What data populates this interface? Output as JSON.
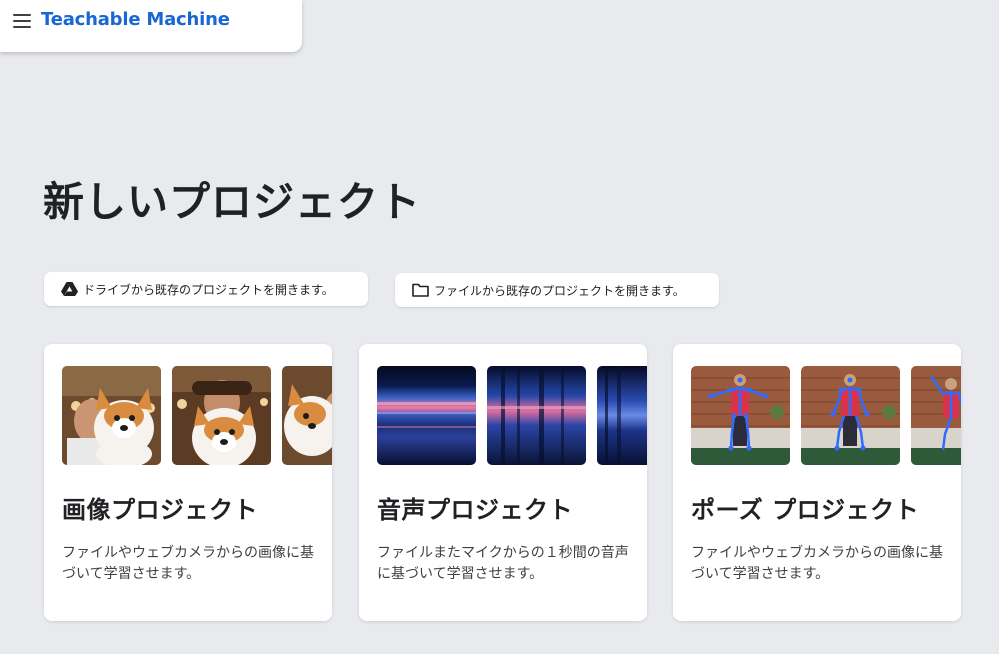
{
  "header": {
    "brand": "Teachable Machine",
    "menu_icon": "hamburger-menu-icon"
  },
  "main": {
    "title": "新しいプロジェクト",
    "open_buttons": [
      {
        "icon": "google-drive-icon",
        "label": "ドライブから既存のプロジェクトを開きます。"
      },
      {
        "icon": "folder-icon",
        "label": "ファイルから既存のプロジェクトを開きます。"
      }
    ],
    "cards": [
      {
        "title": "画像プロジェクト",
        "description": "ファイルやウェブカメラからの画像に基づいて学習させます。",
        "thumbnail_subject": "person-with-corgi-plush"
      },
      {
        "title": "音声プロジェクト",
        "description": "ファイルまたマイクからの１秒間の音声に基づいて学習させます。",
        "thumbnail_subject": "audio-spectrogram"
      },
      {
        "title": "ポーズ プロジェクト",
        "description": "ファイルやウェブカメラからの画像に基づいて学習させます。",
        "thumbnail_subject": "person-pose-skeleton"
      }
    ]
  },
  "colors": {
    "background": "#e8eaed",
    "brand": "#1967d2",
    "card": "#ffffff",
    "text": "#202124"
  }
}
